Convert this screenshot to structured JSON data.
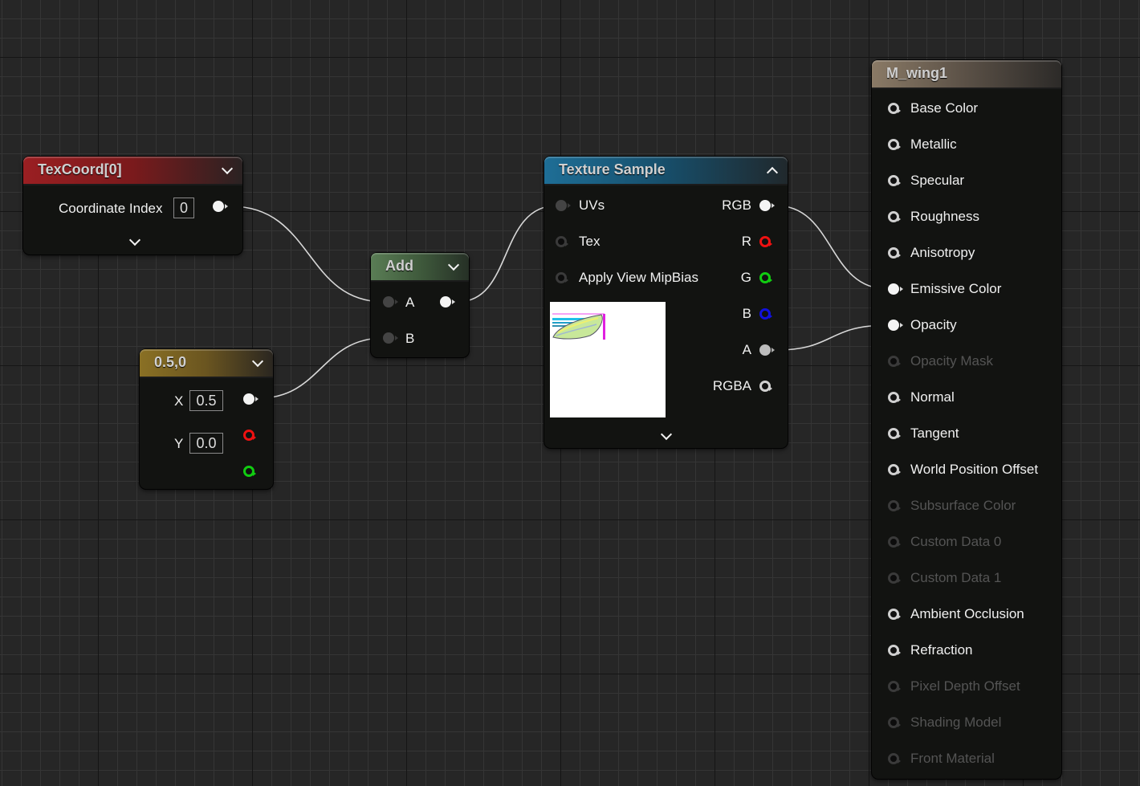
{
  "graph": {
    "nodes": {
      "texcoord": {
        "title": "TexCoord[0]",
        "header_color": "#9a1f22",
        "inputs": [],
        "property_label": "Coordinate Index",
        "property_value": "0"
      },
      "constant2": {
        "title": "0.5,0",
        "header_color": "#8a7024",
        "x_label": "X",
        "x_value": "0.5",
        "y_label": "Y",
        "y_value": "0.0"
      },
      "add": {
        "title": "Add",
        "header_color": "#5a7d55",
        "inputs": [
          "A",
          "B"
        ]
      },
      "texture_sample": {
        "title": "Texture Sample",
        "header_color": "#1e6e96",
        "inputs": [
          "UVs",
          "Tex",
          "Apply View MipBias"
        ],
        "outputs": [
          "RGB",
          "R",
          "G",
          "B",
          "A",
          "RGBA"
        ]
      },
      "material": {
        "title": "M_wing1",
        "header_color": "#8a7a66",
        "inputs": [
          {
            "label": "Base Color",
            "enabled": true,
            "connected": false
          },
          {
            "label": "Metallic",
            "enabled": true,
            "connected": false
          },
          {
            "label": "Specular",
            "enabled": true,
            "connected": false
          },
          {
            "label": "Roughness",
            "enabled": true,
            "connected": false
          },
          {
            "label": "Anisotropy",
            "enabled": true,
            "connected": false
          },
          {
            "label": "Emissive Color",
            "enabled": true,
            "connected": true
          },
          {
            "label": "Opacity",
            "enabled": true,
            "connected": true
          },
          {
            "label": "Opacity Mask",
            "enabled": false,
            "connected": false
          },
          {
            "label": "Normal",
            "enabled": true,
            "connected": false
          },
          {
            "label": "Tangent",
            "enabled": true,
            "connected": false
          },
          {
            "label": "World Position Offset",
            "enabled": true,
            "connected": false
          },
          {
            "label": "Subsurface Color",
            "enabled": false,
            "connected": false
          },
          {
            "label": "Custom Data 0",
            "enabled": false,
            "connected": false
          },
          {
            "label": "Custom Data 1",
            "enabled": false,
            "connected": false
          },
          {
            "label": "Ambient Occlusion",
            "enabled": true,
            "connected": false
          },
          {
            "label": "Refraction",
            "enabled": true,
            "connected": false
          },
          {
            "label": "Pixel Depth Offset",
            "enabled": false,
            "connected": false
          },
          {
            "label": "Shading Model",
            "enabled": false,
            "connected": false
          },
          {
            "label": "Front Material",
            "enabled": false,
            "connected": false
          }
        ]
      }
    },
    "connections": [
      {
        "from": "TexCoord[0].out",
        "to": "Add.A"
      },
      {
        "from": "0.5,0.out",
        "to": "Add.B"
      },
      {
        "from": "Add.out",
        "to": "Texture Sample.UVs"
      },
      {
        "from": "Texture Sample.RGB",
        "to": "M_wing1.Emissive Color"
      },
      {
        "from": "Texture Sample.A",
        "to": "M_wing1.Opacity"
      }
    ]
  }
}
